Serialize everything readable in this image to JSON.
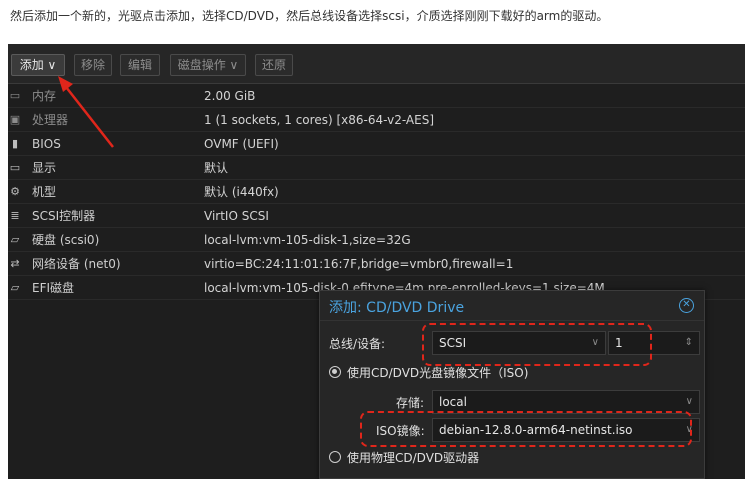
{
  "caption": "然后添加一个新的，光驱点击添加，选择CD/DVD，然后总线设备选择scsi，介质选择刚刚下载好的arm的驱动。",
  "toolbar": {
    "add": "添加 ∨",
    "remove": "移除",
    "edit": "编辑",
    "disk_ops": "磁盘操作 ∨",
    "revert": "还原"
  },
  "hardware": [
    {
      "icon": "memory-icon",
      "glyph": "▭",
      "name": "内存",
      "value": "2.00 GiB"
    },
    {
      "icon": "cpu-icon",
      "glyph": "▣",
      "name": "处理器",
      "value": "1 (1 sockets, 1 cores) [x86-64-v2-AES]"
    },
    {
      "icon": "bios-icon",
      "glyph": "▮",
      "name": "BIOS",
      "value": "OVMF (UEFI)"
    },
    {
      "icon": "display-icon",
      "glyph": "▭",
      "name": "显示",
      "value": "默认"
    },
    {
      "icon": "machine-icon",
      "glyph": "⚙",
      "name": "机型",
      "value": "默认 (i440fx)"
    },
    {
      "icon": "scsi-controller-icon",
      "glyph": "≣",
      "name": "SCSI控制器",
      "value": "VirtIO SCSI"
    },
    {
      "icon": "hard-disk-icon",
      "glyph": "▱",
      "name": "硬盘 (scsi0)",
      "value": "local-lvm:vm-105-disk-1,size=32G"
    },
    {
      "icon": "network-icon",
      "glyph": "⇄",
      "name": "网络设备 (net0)",
      "value": "virtio=BC:24:11:01:16:7F,bridge=vmbr0,firewall=1"
    },
    {
      "icon": "efi-disk-icon",
      "glyph": "▱",
      "name": "EFI磁盘",
      "value": "local-lvm:vm-105-disk-0,efitype=4m,pre-enrolled-keys=1,size=4M"
    }
  ],
  "dialog": {
    "title": "添加: CD/DVD Drive",
    "bus_label": "总线/设备:",
    "bus_value": "SCSI",
    "device_number": "1",
    "radio_iso": "使用CD/DVD光盘镜像文件（ISO)",
    "storage_label": "存储:",
    "storage_value": "local",
    "iso_label": "ISO镜像:",
    "iso_value": "debian-12.8.0-arm64-netinst.iso",
    "radio_physical": "使用物理CD/DVD驱动器"
  },
  "colors": {
    "accent": "#4aa3df",
    "annotation": "#e0261b",
    "panel": "#1e1e1e"
  }
}
